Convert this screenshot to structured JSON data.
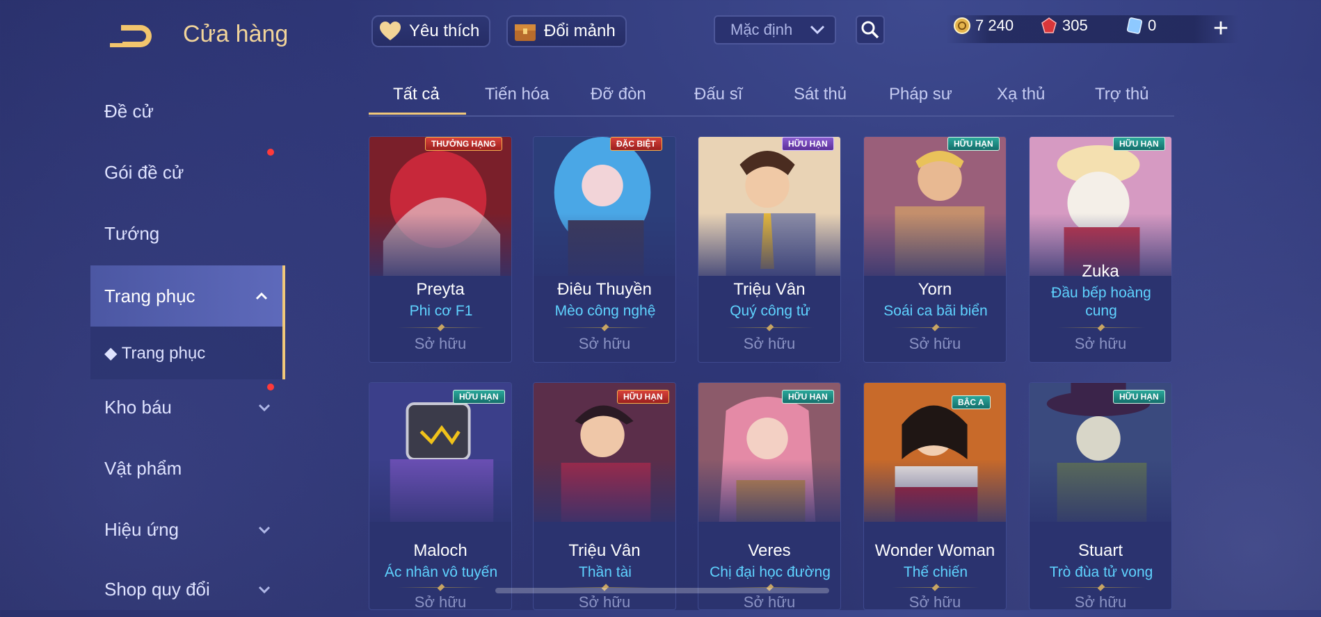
{
  "header": {
    "title": "Cửa hàng",
    "favorite_label": "Yêu thích",
    "exchange_label": "Đổi mảnh",
    "sort_selected": "Mặc định",
    "gold": "7 240",
    "gems": "305",
    "vouchers": "0",
    "plus_label": "+"
  },
  "sidebar": {
    "items": [
      {
        "label": "Đề cử"
      },
      {
        "label": "Gói đề cử"
      },
      {
        "label": "Tướng"
      },
      {
        "label": "Trang phục"
      },
      {
        "label": "Trang phục"
      },
      {
        "label": "Kho báu"
      },
      {
        "label": "Vật phẩm"
      },
      {
        "label": "Hiệu ứng"
      },
      {
        "label": "Shop quy đổi"
      }
    ]
  },
  "tabs": [
    {
      "label": "Tất cả"
    },
    {
      "label": "Tiến hóa"
    },
    {
      "label": "Đỡ đòn"
    },
    {
      "label": "Đấu sĩ"
    },
    {
      "label": "Sát thủ"
    },
    {
      "label": "Pháp sư"
    },
    {
      "label": "Xạ thủ"
    },
    {
      "label": "Trợ thủ"
    }
  ],
  "cards": [
    {
      "hero": "Preyta",
      "skin": "Phi cơ F1",
      "status": "Sở hữu",
      "tag": "THƯỞNG HẠNG",
      "tag_color": "red"
    },
    {
      "hero": "Điêu Thuyền",
      "skin": "Mèo công nghệ",
      "status": "Sở hữu",
      "tag": "ĐẶC BIỆT",
      "tag_color": "red"
    },
    {
      "hero": "Triệu Vân",
      "skin": "Quý công tử",
      "status": "Sở hữu",
      "tag": "HỮU HẠN",
      "tag_color": "purple"
    },
    {
      "hero": "Yorn",
      "skin": "Soái ca bãi biển",
      "status": "Sở hữu",
      "tag": "HỮU HẠN",
      "tag_color": "teal"
    },
    {
      "hero": "Zuka",
      "skin": "Đầu bếp hoàng cung",
      "status": "Sở hữu",
      "tag": "HỮU HẠN",
      "tag_color": "teal"
    },
    {
      "hero": "Maloch",
      "skin": "Ác nhân vô tuyến",
      "status": "Sở hữu",
      "tag": "HỮU HẠN",
      "tag_color": "teal"
    },
    {
      "hero": "Triệu Vân",
      "skin": "Thần tài",
      "status": "Sở hữu",
      "tag": "HỮU HẠN",
      "tag_color": "red"
    },
    {
      "hero": "Veres",
      "skin": "Chị đại học đường",
      "status": "Sở hữu",
      "tag": "HỮU HẠN",
      "tag_color": "teal"
    },
    {
      "hero": "Wonder Woman",
      "skin": "Thế chiến",
      "status": "Sở hữu",
      "tag": "BẬC A",
      "tag_color": "teal"
    },
    {
      "hero": "Stuart",
      "skin": "Trò đùa tử vong",
      "status": "Sở hữu",
      "tag": "HỮU HẠN",
      "tag_color": "teal"
    }
  ]
}
